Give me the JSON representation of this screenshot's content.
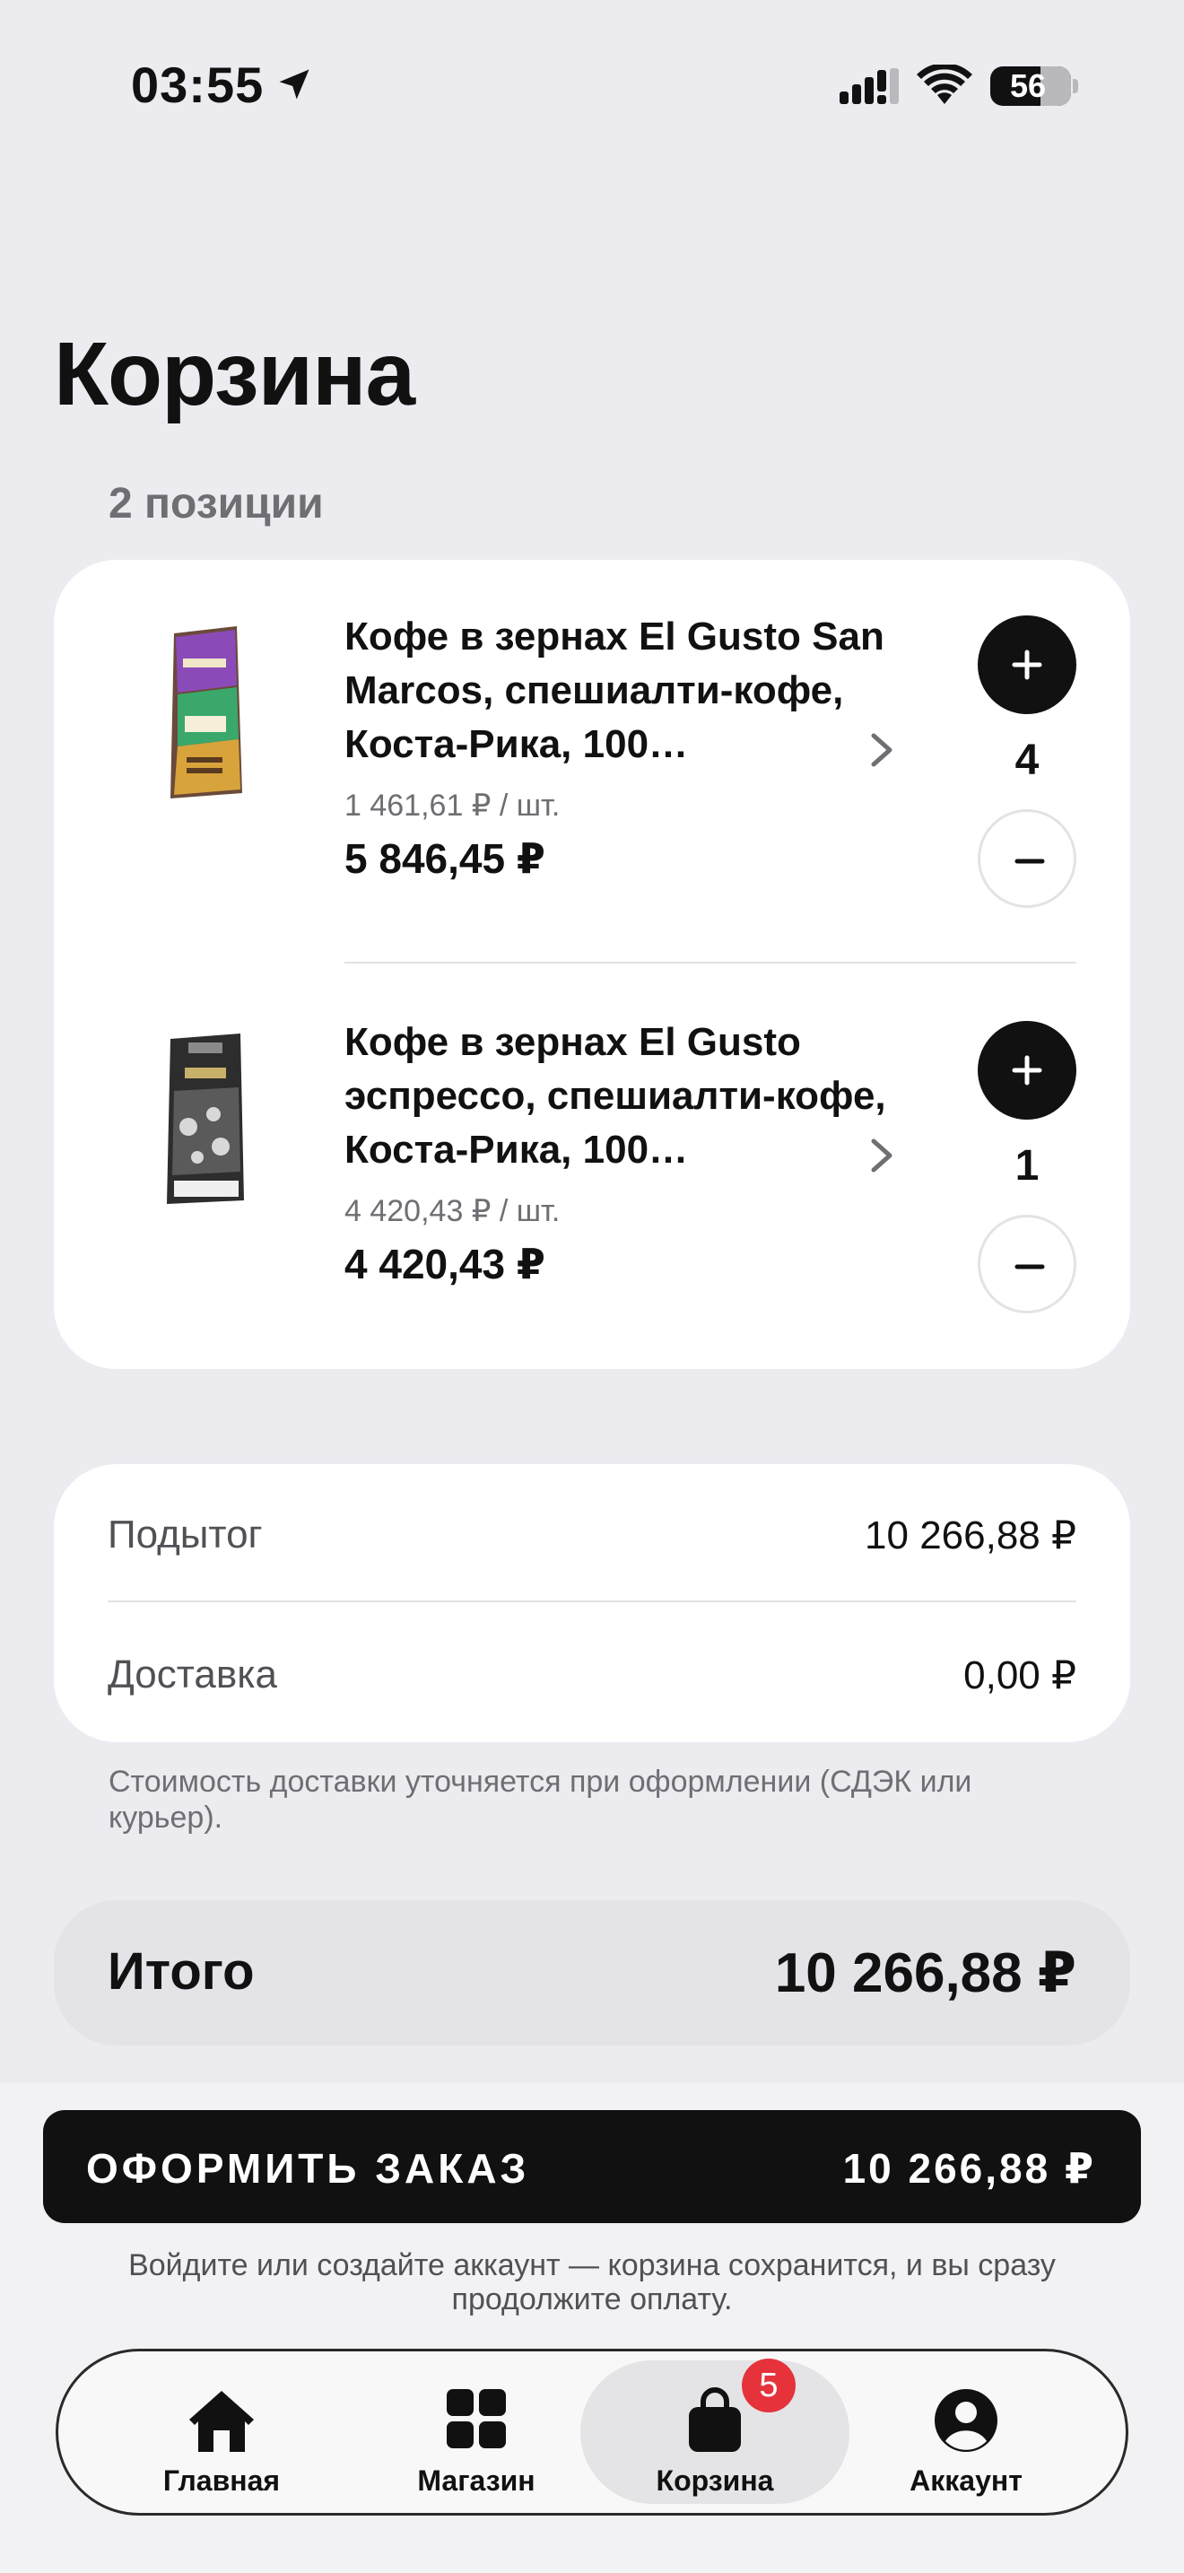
{
  "status_bar": {
    "time": "03:55",
    "battery": "56"
  },
  "header": {
    "title": "Корзина",
    "count": "2 позиции"
  },
  "cart": {
    "items": [
      {
        "name": "Кофе в зернах El Gusto San Marcos, спешиалти-кофе, Коста-Рика, 100…",
        "unit_price": "1 461,61 ₽ / шт.",
        "total": "5 846,45 ₽",
        "quantity": "4"
      },
      {
        "name": "Кофе в зернах El Gusto эспрессо, спешиалти-кофе, Коста-Рика, 100…",
        "unit_price": "4 420,43 ₽ / шт.",
        "total": "4 420,43 ₽",
        "quantity": "1"
      }
    ]
  },
  "summary": {
    "subtotal_label": "Подытог",
    "subtotal_value": "10 266,88 ₽",
    "delivery_label": "Доставка",
    "delivery_value": "0,00 ₽",
    "note": "Стоимость доставки уточняется при оформлении (СДЭК или курьер).",
    "total_label": "Итого",
    "total_value": "10 266,88 ₽"
  },
  "checkout": {
    "label": "ОФОРМИТЬ ЗАКАЗ",
    "total": "10 266,88 ₽",
    "note": "Войдите или создайте аккаунт — корзина сохранится, и вы сразу продолжите оплату."
  },
  "tabbar": {
    "tabs": [
      {
        "label": "Главная",
        "icon": "home-icon"
      },
      {
        "label": "Магазин",
        "icon": "grid-icon"
      },
      {
        "label": "Корзина",
        "icon": "bag-icon"
      },
      {
        "label": "Аккаунт",
        "icon": "account-icon"
      }
    ],
    "cart_badge": "5",
    "active": "Корзина"
  }
}
